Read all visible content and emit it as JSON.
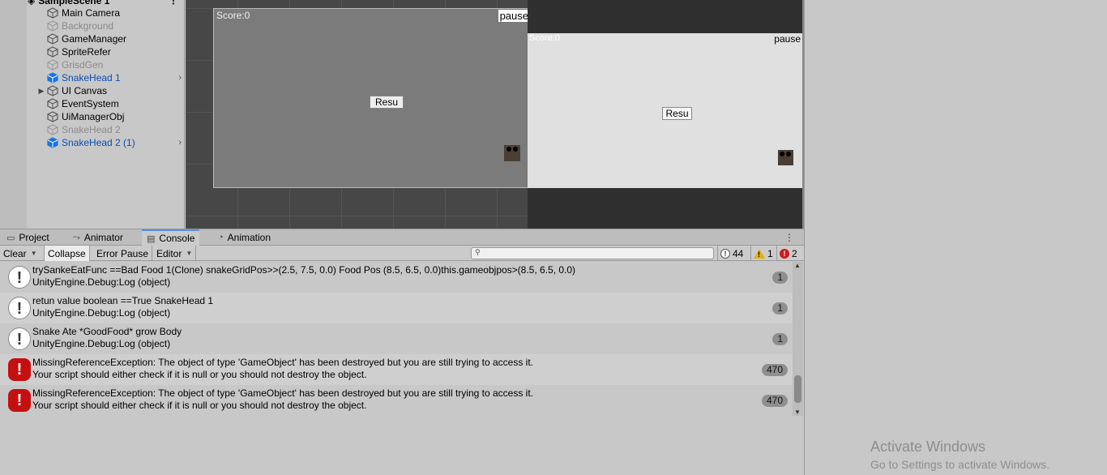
{
  "hierarchy": {
    "scene_name": "SampleScene 1",
    "items": [
      {
        "label": "Main Camera",
        "state": "normal",
        "arrow": "",
        "chevron": ""
      },
      {
        "label": "Background",
        "state": "disabled",
        "arrow": "",
        "chevron": ""
      },
      {
        "label": "GameManager",
        "state": "normal",
        "arrow": "",
        "chevron": ""
      },
      {
        "label": "SpriteRefer",
        "state": "normal",
        "arrow": "",
        "chevron": ""
      },
      {
        "label": "GrisdGen",
        "state": "disabled",
        "arrow": "",
        "chevron": ""
      },
      {
        "label": "SnakeHead 1",
        "state": "prefab",
        "arrow": "",
        "chevron": "›"
      },
      {
        "label": "UI Canvas",
        "state": "normal",
        "arrow": "▶",
        "chevron": ""
      },
      {
        "label": "EventSystem",
        "state": "normal",
        "arrow": "",
        "chevron": ""
      },
      {
        "label": "UiManagerObj",
        "state": "normal",
        "arrow": "",
        "chevron": ""
      },
      {
        "label": "SnakeHead 2",
        "state": "disabled",
        "arrow": "",
        "chevron": ""
      },
      {
        "label": "SnakeHead 2 (1)",
        "state": "prefab",
        "arrow": "",
        "chevron": "›"
      }
    ]
  },
  "scene_view": {
    "score": "Score:0",
    "pause": "pause",
    "resume": "Resu"
  },
  "game_view": {
    "score": "Score:0",
    "pause": "pause",
    "resume": "Resu"
  },
  "tabs": {
    "project": "Project",
    "animator": "Animator",
    "console": "Console",
    "animation": "Animation"
  },
  "toolbar": {
    "clear": "Clear",
    "collapse": "Collapse",
    "error_pause": "Error Pause",
    "editor": "Editor",
    "search_placeholder": "",
    "info_count": "44",
    "warning_count": "1",
    "error_count": "2"
  },
  "logs": [
    {
      "type": "info",
      "line1": "trySankeEatFunc ==Bad Food 1(Clone) snakeGridPos>>(2.5, 7.5, 0.0) Food Pos (8.5, 6.5, 0.0)this.gameobjpos>(8.5, 6.5, 0.0)",
      "line2": "UnityEngine.Debug:Log (object)",
      "count": "1"
    },
    {
      "type": "info",
      "line1": "retun value boolean ==True SnakeHead 1",
      "line2": "UnityEngine.Debug:Log (object)",
      "count": "1"
    },
    {
      "type": "info",
      "line1": "Snake Ate *GoodFood* grow Body",
      "line2": "UnityEngine.Debug:Log (object)",
      "count": "1"
    },
    {
      "type": "error",
      "line1": "MissingReferenceException: The object of type 'GameObject' has been destroyed but you are still trying to access it.",
      "line2": "Your script should either check if it is null or you should not destroy the object.",
      "count": "470"
    },
    {
      "type": "error",
      "line1": "MissingReferenceException: The object of type 'GameObject' has been destroyed but you are still trying to access it.",
      "line2": "Your script should either check if it is null or you should not destroy the object.",
      "count": "470"
    }
  ],
  "watermark": {
    "title": "Activate Windows",
    "subtitle": "Go to Settings to activate Windows."
  },
  "colors": {
    "prefab_blue": "#0b4fb3",
    "error_red": "#c41010",
    "warning_yellow": "#e6b000"
  }
}
